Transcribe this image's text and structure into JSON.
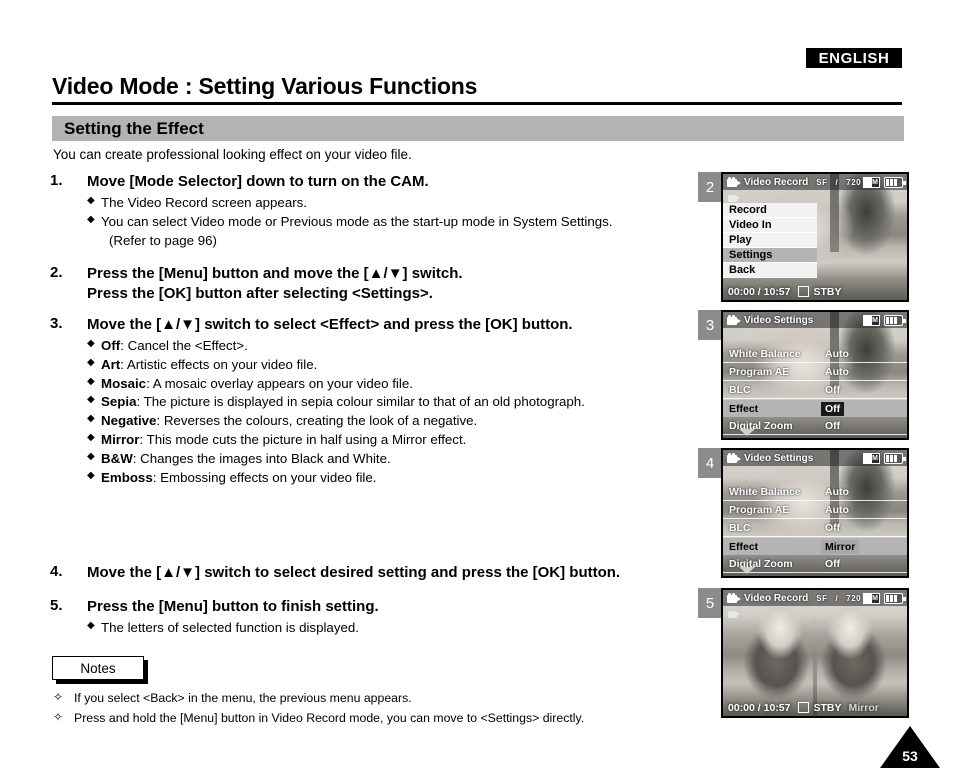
{
  "header": {
    "language_badge": "ENGLISH",
    "title": "Video Mode : Setting Various Functions",
    "section": "Setting the Effect",
    "intro": "You can create professional looking effect on your video file."
  },
  "steps": [
    {
      "num": "1.",
      "head": "Move [Mode Selector] down to turn on the CAM.",
      "bullets": [
        "The Video Record screen appears.",
        "You can select Video mode or Previous mode as the start-up mode in System Settings.",
        "(Refer to page 96)"
      ]
    },
    {
      "num": "2.",
      "head_line1": "Press the [Menu] button and move the [▲/▼] switch.",
      "head_line2": "Press the [OK] button after selecting <Settings>."
    },
    {
      "num": "3.",
      "head": "Move the [▲/▼] switch to select <Effect> and press the [OK] button.",
      "options": [
        {
          "name": "Off",
          "desc": ": Cancel the <Effect>."
        },
        {
          "name": "Art",
          "desc": ": Artistic effects on your video file."
        },
        {
          "name": "Mosaic",
          "desc": ": A mosaic overlay appears on your video file."
        },
        {
          "name": "Sepia",
          "desc": ": The picture is displayed in sepia colour similar to that of an old photograph."
        },
        {
          "name": "Negative",
          "desc": ": Reverses the colours, creating the look of a negative."
        },
        {
          "name": "Mirror",
          "desc": ": This mode cuts the picture in half using a Mirror effect."
        },
        {
          "name": "B&W",
          "desc": ": Changes the images into Black and White."
        },
        {
          "name": "Emboss",
          "desc": ": Embossing effects on your video file."
        }
      ]
    },
    {
      "num": "4.",
      "head": "Move the [▲/▼] switch to select desired setting and press the [OK] button."
    },
    {
      "num": "5.",
      "head": "Press the [Menu] button to finish setting.",
      "bullets": [
        "The letters of selected function is displayed."
      ]
    }
  ],
  "notes": {
    "label": "Notes",
    "items": [
      "If you select <Back> in the menu, the previous menu appears.",
      "Press and hold the [Menu] button in Video Record mode, you can move to <Settings> directly."
    ]
  },
  "page_number": "53",
  "screens": [
    {
      "badge": "2",
      "title": "Video Record",
      "quality": "SF",
      "resolution": "720",
      "mem_label": "M",
      "menu": [
        {
          "label": "Record",
          "selected": false
        },
        {
          "label": "Video In",
          "selected": false
        },
        {
          "label": "Play",
          "selected": false
        },
        {
          "label": "Settings",
          "selected": true
        },
        {
          "label": "Back",
          "selected": false
        }
      ],
      "status_time": "00:00 / 10:57",
      "status_mode": "STBY",
      "status_effect": ""
    },
    {
      "badge": "3",
      "title": "Video Settings",
      "mem_label": "M",
      "rows": [
        {
          "label": "White Balance",
          "value": "Auto",
          "highlighted": false
        },
        {
          "label": "Program AE",
          "value": "Auto",
          "highlighted": false
        },
        {
          "label": "BLC",
          "value": "Off",
          "highlighted": false
        },
        {
          "label": "Effect",
          "value": "Off",
          "highlighted": true
        },
        {
          "label": "Digital Zoom",
          "value": "Off",
          "highlighted": false
        }
      ]
    },
    {
      "badge": "4",
      "title": "Video Settings",
      "mem_label": "M",
      "rows": [
        {
          "label": "White Balance",
          "value": "Auto",
          "highlighted": false
        },
        {
          "label": "Program AE",
          "value": "Auto",
          "highlighted": false
        },
        {
          "label": "BLC",
          "value": "Off",
          "highlighted": false
        },
        {
          "label": "Effect",
          "value": "Mirror",
          "highlighted": true
        },
        {
          "label": "Digital Zoom",
          "value": "Off",
          "highlighted": false
        }
      ]
    },
    {
      "badge": "5",
      "title": "Video Record",
      "quality": "SF",
      "resolution": "720",
      "mem_label": "M",
      "status_time": "00:00 / 10:57",
      "status_mode": "STBY",
      "status_effect": "Mirror"
    }
  ],
  "colors": {
    "section_bar": "#b3b3b3",
    "badge": "#8c8c8c",
    "highlight": "#b4b4b4"
  }
}
